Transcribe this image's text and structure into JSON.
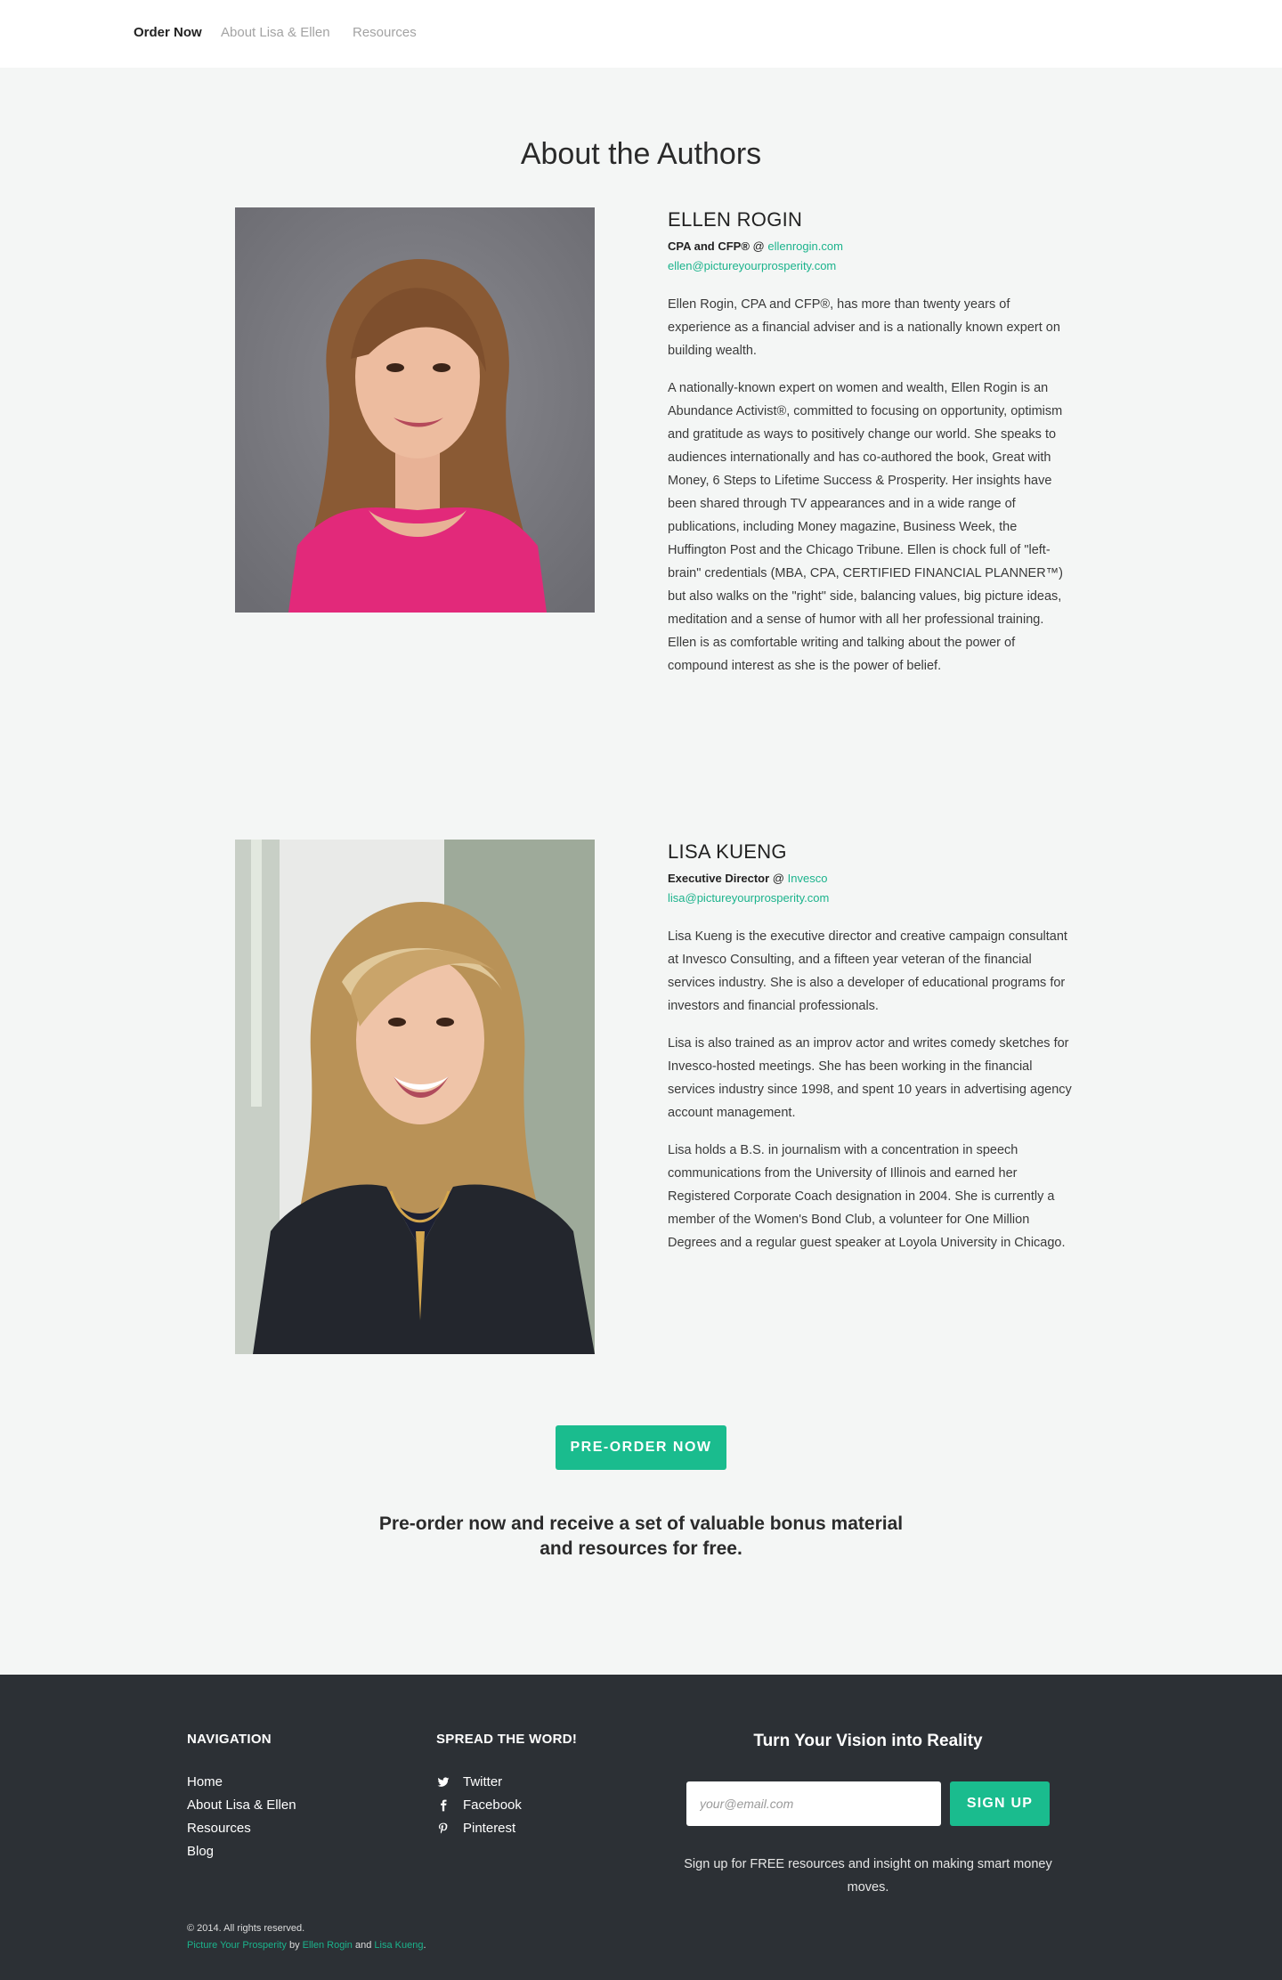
{
  "nav": {
    "order_now": "Order Now",
    "about": "About Lisa & Ellen",
    "resources": "Resources"
  },
  "page_title": "About the Authors",
  "ellen": {
    "name": "ELLEN ROGIN",
    "role": "CPA and CFP®",
    "at": "@",
    "site": "ellenrogin.com",
    "email": "ellen@pictureyourprosperity.com",
    "paragraphs": [
      "Ellen Rogin, CPA and CFP®, has more than twenty years of experience as a financial adviser and is a nationally known expert on building wealth.",
      "A nationally-known expert on women and wealth, Ellen Rogin is an Abundance Activist®, committed to focusing on opportunity, optimism and gratitude as ways to positively change our world. She speaks to audiences internationally and has co-authored the book, Great with Money, 6 Steps to Lifetime Success & Prosperity. Her insights have been shared through TV appearances and in a wide range of publications, including Money magazine, Business Week, the Huffington Post and the Chicago Tribune. Ellen is chock full of \"left-brain\" credentials (MBA, CPA, CERTIFIED FINANCIAL PLANNER™) but also walks on the \"right\" side, balancing values, big picture ideas, meditation and a sense of humor with all her professional training. Ellen is as comfortable writing and talking about the power of compound interest as she is the power of belief."
    ]
  },
  "lisa": {
    "name": "LISA KUENG",
    "role": "Executive Director",
    "at": "@",
    "site": "Invesco",
    "email": "lisa@pictureyourprosperity.com",
    "paragraphs": [
      "Lisa Kueng is the executive director and creative campaign consultant at Invesco Consulting, and a fifteen year veteran of the financial services industry. She is also a developer of educational programs for investors and financial professionals.",
      "Lisa is also trained as an improv actor and writes comedy sketches for Invesco-hosted meetings. She has been working in the financial services industry since 1998, and spent 10 years in advertising agency account management.",
      "Lisa holds a B.S. in journalism with a concentration in speech communications from the University of Illinois and earned her Registered Corporate Coach designation in 2004. She is currently a member of the Women's Bond Club, a volunteer for One Million Degrees and a regular guest speaker at Loyola University in Chicago."
    ]
  },
  "cta": {
    "button": "PRE-ORDER NOW",
    "text": "Pre-order now and receive a set of valuable bonus material and resources for free."
  },
  "footer": {
    "nav_title": "NAVIGATION",
    "nav_items": [
      "Home",
      "About Lisa & Ellen",
      "Resources",
      "Blog"
    ],
    "share_title": "SPREAD THE WORD!",
    "share_items": [
      {
        "icon": "twitter-icon",
        "label": "Twitter"
      },
      {
        "icon": "facebook-icon",
        "label": "Facebook"
      },
      {
        "icon": "pinterest-icon",
        "label": "Pinterest"
      }
    ],
    "signup_title": "Turn Your Vision into Reality",
    "email_placeholder": "your@email.com",
    "signup_button": "SIGN UP",
    "signup_note": "Sign up for FREE resources and insight on making smart money moves.",
    "copyright": "© 2014. All rights reserved.",
    "credit_site": "Picture Your Prosperity",
    "credit_by": "by",
    "credit_author1": "Ellen Rogin",
    "credit_and": "and",
    "credit_author2": "Lisa Kueng",
    "credit_end": "."
  },
  "colors": {
    "accent": "#1abc8e",
    "footer_bg": "#2c3035",
    "page_bg": "#f4f6f5"
  }
}
